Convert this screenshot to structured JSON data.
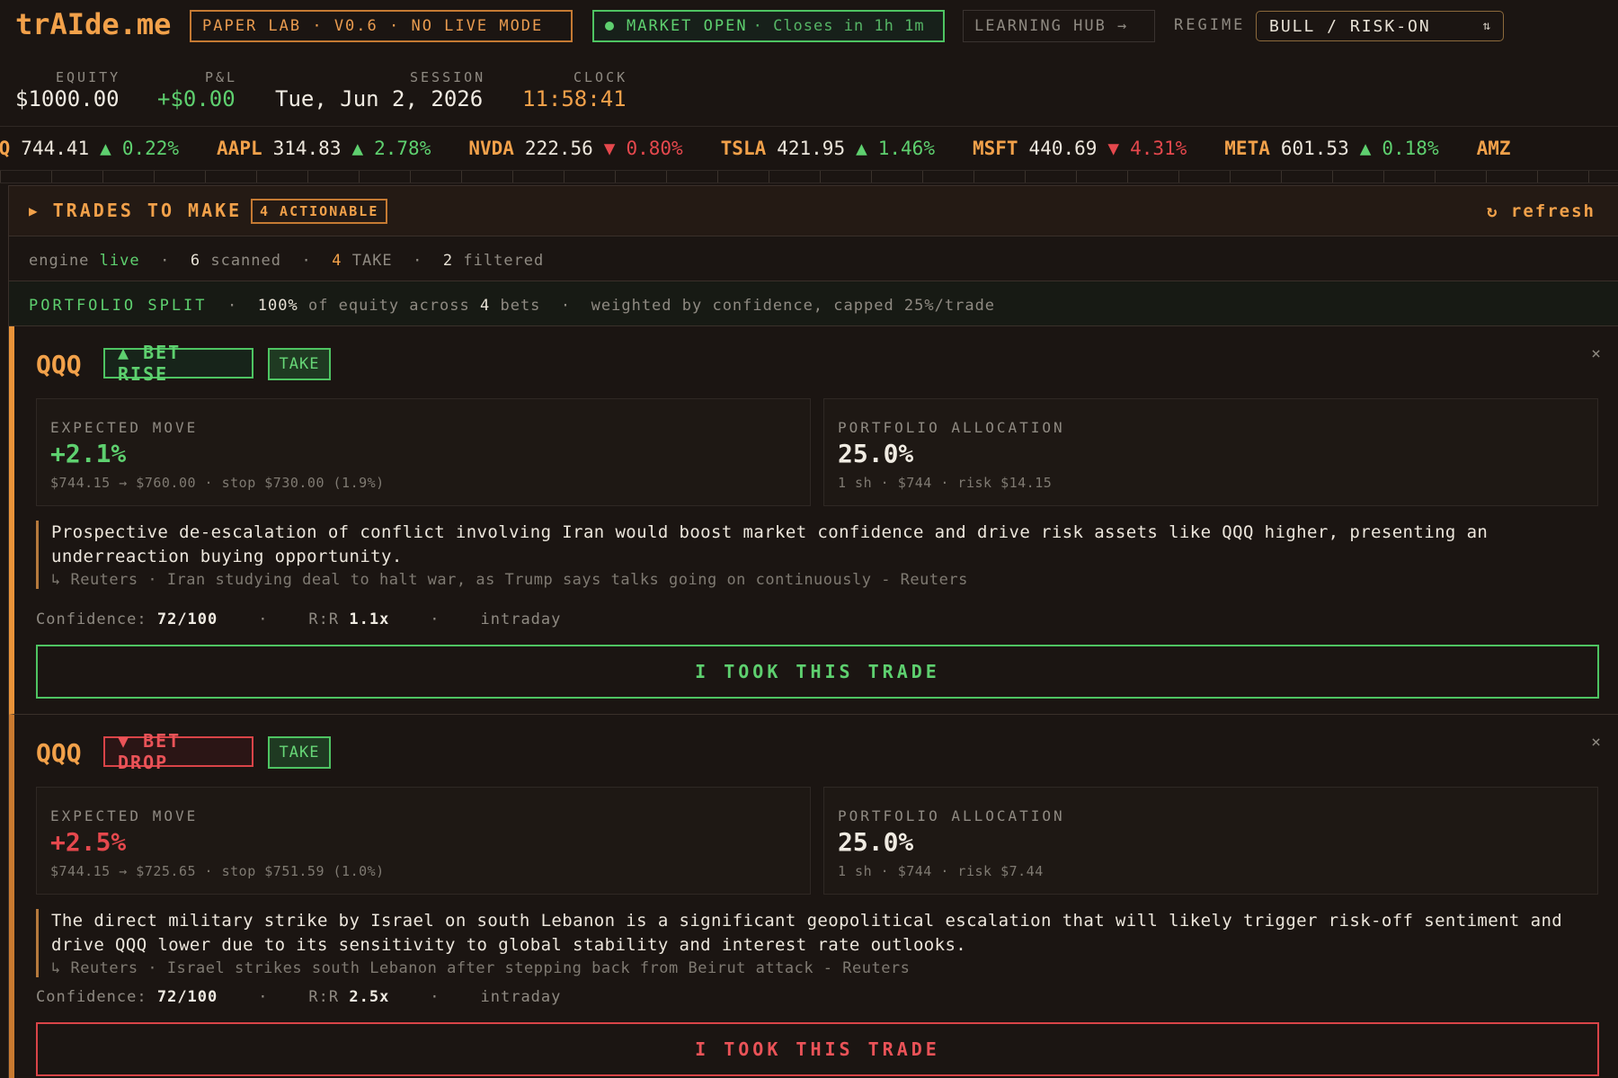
{
  "app": {
    "logo": "trAIde.me",
    "lab_chip": "PAPER LAB · V0.6 · NO LIVE MODE",
    "market": {
      "status": "MARKET OPEN",
      "closes": "· Closes in 1h 1m"
    },
    "hub_link": "LEARNING HUB →",
    "regime": {
      "label": "REGIME",
      "value": "BULL / RISK-ON",
      "arrows": "⌃⌄"
    }
  },
  "stats": {
    "equity": {
      "label": "EQUITY",
      "value": "$1000.00"
    },
    "pnl": {
      "label": "P&L",
      "value": "+$0.00"
    },
    "session": {
      "label": "SESSION",
      "value": "Tue, Jun 2, 2026"
    },
    "clock": {
      "label": "CLOCK",
      "value": "11:58:41"
    }
  },
  "ticker": [
    {
      "sym": "QQ",
      "price": "744.41",
      "arrow": "▲",
      "change": "0.22%",
      "dir": "up"
    },
    {
      "sym": "AAPL",
      "price": "314.83",
      "arrow": "▲",
      "change": "2.78%",
      "dir": "up"
    },
    {
      "sym": "NVDA",
      "price": "222.56",
      "arrow": "▼",
      "change": "0.80%",
      "dir": "down"
    },
    {
      "sym": "TSLA",
      "price": "421.95",
      "arrow": "▲",
      "change": "1.46%",
      "dir": "up"
    },
    {
      "sym": "MSFT",
      "price": "440.69",
      "arrow": "▼",
      "change": "4.31%",
      "dir": "down"
    },
    {
      "sym": "META",
      "price": "601.53",
      "arrow": "▲",
      "change": "0.18%",
      "dir": "up"
    },
    {
      "sym": "AMZ",
      "price": "",
      "arrow": "",
      "change": "",
      "dir": "up"
    }
  ],
  "panel": {
    "title": "TRADES TO MAKE",
    "title_icon": "▶",
    "badge": "4 ACTIONABLE",
    "refresh": "↻ refresh",
    "engine": {
      "prefix": "engine",
      "state": "live",
      "sep": "·",
      "scanned_n": "6",
      "scanned": "scanned",
      "take_n": "4",
      "take": "TAKE",
      "filtered_n": "2",
      "filtered": "filtered"
    },
    "split": {
      "label": "PORTFOLIO SPLIT",
      "sep": "·",
      "pct": "100%",
      "text1": "of equity across",
      "bets_n": "4",
      "text2": "bets",
      "text3": "weighted by confidence, capped 25%/trade"
    }
  },
  "trades": [
    {
      "symbol": "QQQ",
      "direction": "▲ BET RISE",
      "tag": "TAKE",
      "close": "×",
      "expected": {
        "label": "EXPECTED MOVE",
        "value": "+2.1%",
        "sub": "$744.15 → $760.00 · stop $730.00 (1.9%)"
      },
      "allocation": {
        "label": "PORTFOLIO ALLOCATION",
        "value": "25.0%",
        "sub": "1 sh · $744 · risk $14.15"
      },
      "thesis": "Prospective de-escalation of conflict involving Iran would boost market confidence and drive risk assets like QQQ higher, presenting an underreaction buying opportunity.",
      "source": "↳ Reuters · Iran studying deal to halt war, as Trump says talks going on continuously - Reuters",
      "meta": {
        "conf_label": "Confidence:",
        "conf": "72/100",
        "sep": "·",
        "rr_label": "R:R",
        "rr": "1.1x",
        "horizon": "intraday"
      },
      "action": "I TOOK THIS TRADE",
      "colors": {
        "accent": "#5ed06f"
      }
    },
    {
      "symbol": "QQQ",
      "direction": "▼ BET DROP",
      "tag": "TAKE",
      "close": "×",
      "expected": {
        "label": "EXPECTED MOVE",
        "value": "+2.5%",
        "sub": "$744.15 → $725.65 · stop $751.59 (1.0%)"
      },
      "allocation": {
        "label": "PORTFOLIO ALLOCATION",
        "value": "25.0%",
        "sub": "1 sh · $744 · risk $7.44"
      },
      "thesis": "The direct military strike by Israel on south Lebanon is a significant geopolitical escalation that will likely trigger risk-off sentiment and drive QQQ lower due to its sensitivity to global stability and interest rate outlooks.",
      "source": "↳ Reuters · Israel strikes south Lebanon after stepping back from Beirut attack - Reuters",
      "meta": {
        "conf_label": "Confidence:",
        "conf": "72/100",
        "sep": "·",
        "rr_label": "R:R",
        "rr": "2.5x",
        "horizon": "intraday"
      },
      "action": "I TOOK THIS TRADE",
      "colors": {
        "accent": "#ea5358"
      }
    }
  ]
}
